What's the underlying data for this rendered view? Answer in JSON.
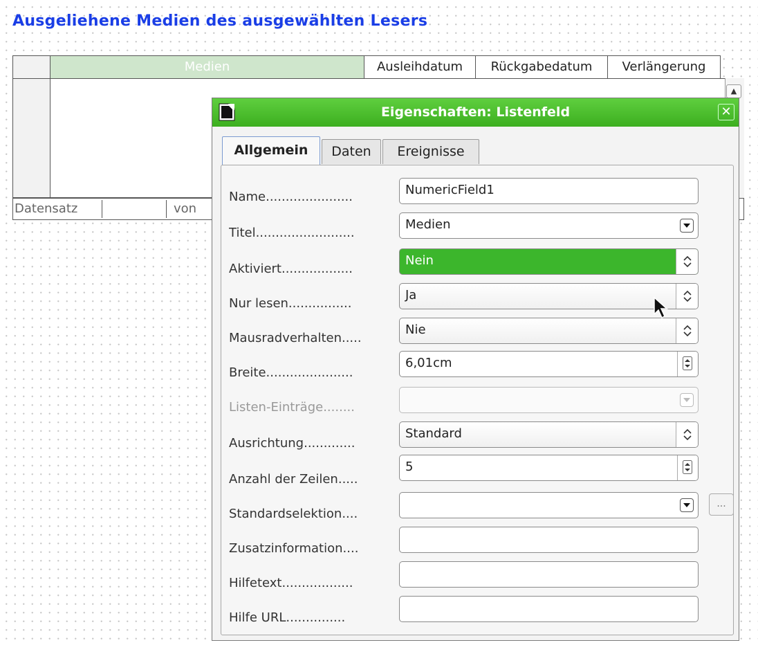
{
  "heading": "Ausgeliehene Medien des ausgewählten Lesers",
  "grid": {
    "columns": [
      "Medien",
      "Ausleihdatum",
      "Rückgabedatum",
      "Verlängerung"
    ],
    "nav": {
      "record_label": "Datensatz",
      "of_label": "von"
    }
  },
  "dialog": {
    "title": "Eigenschaften: Listenfeld",
    "tabs": [
      "Allgemein",
      "Daten",
      "Ereignisse"
    ],
    "fields": [
      {
        "label": "Name......................",
        "value": "NumericField1",
        "control": "text"
      },
      {
        "label": "Titel.........................",
        "value": "Medien",
        "control": "dropdown"
      },
      {
        "label": "Aktiviert..................",
        "value": "Nein",
        "control": "spin-list"
      },
      {
        "label": "Nur lesen................",
        "value": "Ja",
        "control": "spin-list"
      },
      {
        "label": "Mausradverhalten.....",
        "value": "Nie",
        "control": "spin-list"
      },
      {
        "label": "Breite......................",
        "value": "6,01cm",
        "control": "spin-numeric"
      },
      {
        "label": "Listen-Einträge........",
        "value": "",
        "control": "dropdown-disabled"
      },
      {
        "label": "Ausrichtung.............",
        "value": "Standard",
        "control": "spin-list"
      },
      {
        "label": "Anzahl der Zeilen.....",
        "value": "5",
        "control": "spin-numeric"
      },
      {
        "label": "Standardselektion....",
        "value": "",
        "control": "dropdown-with-button"
      },
      {
        "label": "Zusatzinformation....",
        "value": "",
        "control": "text"
      },
      {
        "label": "Hilfetext..................",
        "value": "",
        "control": "text"
      },
      {
        "label": "Hilfe URL...............",
        "value": "",
        "control": "text"
      }
    ],
    "dots_button": "..."
  },
  "colors": {
    "titlebar": "#3cae1f",
    "heading": "#1a3ee6",
    "selection": "#3cb62c",
    "medien_header": "#cfe6cc"
  },
  "icons": {
    "app": "libreoffice-document-icon",
    "close": "close-icon",
    "pointer": "mouse-pointer-icon"
  }
}
